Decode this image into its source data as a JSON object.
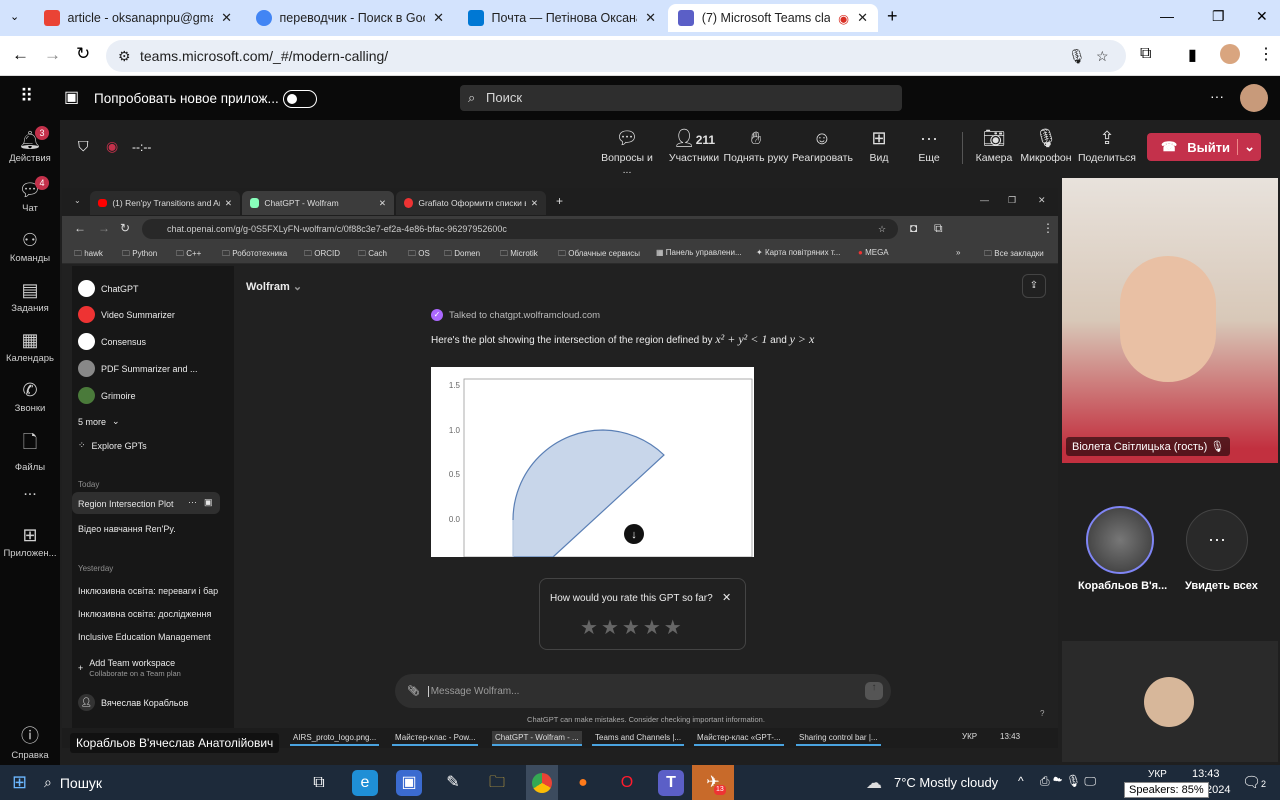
{
  "browser": {
    "tabs": [
      {
        "label": "article - oksanapnpu@gmail.com",
        "icon": "gmail-icon",
        "color": "#ea4335"
      },
      {
        "label": "переводчик - Поиск в Google",
        "icon": "google-icon",
        "color": "#4285f4"
      },
      {
        "label": "Почта — Петінова Оксана Бор",
        "icon": "outlook-icon",
        "color": "#0078d4"
      },
      {
        "label": "(7) Microsoft Teams classic",
        "icon": "teams-icon",
        "color": "#5b5fc7"
      }
    ],
    "url": "teams.microsoft.com/_#/modern-calling/"
  },
  "teams": {
    "try_new": "Попробовать новое прилож...",
    "search_placeholder": "Поиск",
    "rail": [
      {
        "label": "Действия",
        "icon": "bell-icon",
        "badge": "3"
      },
      {
        "label": "Чат",
        "icon": "chat-icon",
        "badge": "4"
      },
      {
        "label": "Команды",
        "icon": "teams-group-icon"
      },
      {
        "label": "Задания",
        "icon": "assignments-icon"
      },
      {
        "label": "Календарь",
        "icon": "calendar-icon"
      },
      {
        "label": "Звонки",
        "icon": "phone-icon"
      },
      {
        "label": "Файлы",
        "icon": "file-icon"
      },
      {
        "label": "...",
        "icon": "more-icon"
      },
      {
        "label": "Приложен...",
        "icon": "apps-icon"
      },
      {
        "label": "Справка",
        "icon": "help-icon"
      }
    ],
    "timer": "--:--",
    "toolbar": [
      {
        "label": "Вопросы и ...",
        "icon": "qa-icon"
      },
      {
        "label": "Участники",
        "icon": "people-icon",
        "count": "211"
      },
      {
        "label": "Поднять руку",
        "icon": "hand-icon"
      },
      {
        "label": "Реагировать",
        "icon": "smile-icon"
      },
      {
        "label": "Вид",
        "icon": "grid-icon"
      },
      {
        "label": "Еще",
        "icon": "more-icon"
      },
      {
        "label": "Камера",
        "icon": "camera-off-icon"
      },
      {
        "label": "Микрофон",
        "icon": "mic-off-icon"
      },
      {
        "label": "Поделиться",
        "icon": "share-icon"
      }
    ],
    "leave": "Выйти",
    "video_name": "Віолета Світлицька (гость)",
    "participant": "Корабльов В'я...",
    "see_all": "Увидеть всех",
    "presenter": "Корабльов В'ячеслав Анатолійович"
  },
  "shared": {
    "tabs": [
      "(1) Ren'py Transitions and Anim",
      "ChatGPT - Wolfram",
      "Grafiato Оформити списки вн"
    ],
    "url": "chat.openai.com/g/g-0S5FXLyFN-wolfram/c/0f88c3e7-ef2a-4e86-bfac-96297952600c",
    "bookmarks": [
      "hawk",
      "Python",
      "C++",
      "Робототехника",
      "ORCID",
      "Cach",
      "OS",
      "Domen",
      "Microtik",
      "Облачные сервисы",
      "Панель управлени...",
      "Карта повітряних т...",
      "MEGA"
    ],
    "all_bookmarks": "Все закладки",
    "gpts": [
      "ChatGPT",
      "Video Summarizer",
      "Consensus",
      "PDF Summarizer and ...",
      "Grimoire"
    ],
    "more": "5 more",
    "explore": "Explore GPTs",
    "today": "Today",
    "today_items": [
      "Region Intersection Plot",
      "Відео навчання Ren'Py."
    ],
    "yesterday": "Yesterday",
    "yesterday_items": [
      "Інклюзивна освіта: переваги і бар",
      "Інклюзивна освіта: дослідження",
      "Inclusive Education Management"
    ],
    "add_team": "Add Team workspace",
    "add_team_sub": "Collaborate on a Team plan",
    "user": "Вячеслав Корабльов",
    "model": "Wolfram",
    "talked": "Talked to chatgpt.wolframcloud.com",
    "answer": "Here's the plot showing the intersection of the region defined by",
    "formula1": "x² + y² < 1",
    "and": "and",
    "formula2": "y > x",
    "plot_ticks": [
      "1.5",
      "1.0",
      "0.5",
      "0.0"
    ],
    "rate": "How would you rate this GPT so far?",
    "stars": 5,
    "msg_placeholder": "Message Wolfram...",
    "disclaimer": "ChatGPT can make mistakes. Consider checking important information.",
    "taskbar": [
      "AIRS_proto_logo.png...",
      "Майстер-клас - Pow...",
      "ChatGPT - Wolfram - ...",
      "Teams and Channels |...",
      "Майстер-клас «GPT-...",
      "Sharing control bar |..."
    ],
    "lang": "УКР",
    "time": "13:43"
  },
  "windows": {
    "search": "Пошук",
    "weather": "7°C  Mostly cloudy",
    "lang": "УКР",
    "time": "13:43",
    "date": "2024",
    "tooltip": "Speakers: 85%",
    "telegram_badge": "13",
    "notif": "2"
  }
}
